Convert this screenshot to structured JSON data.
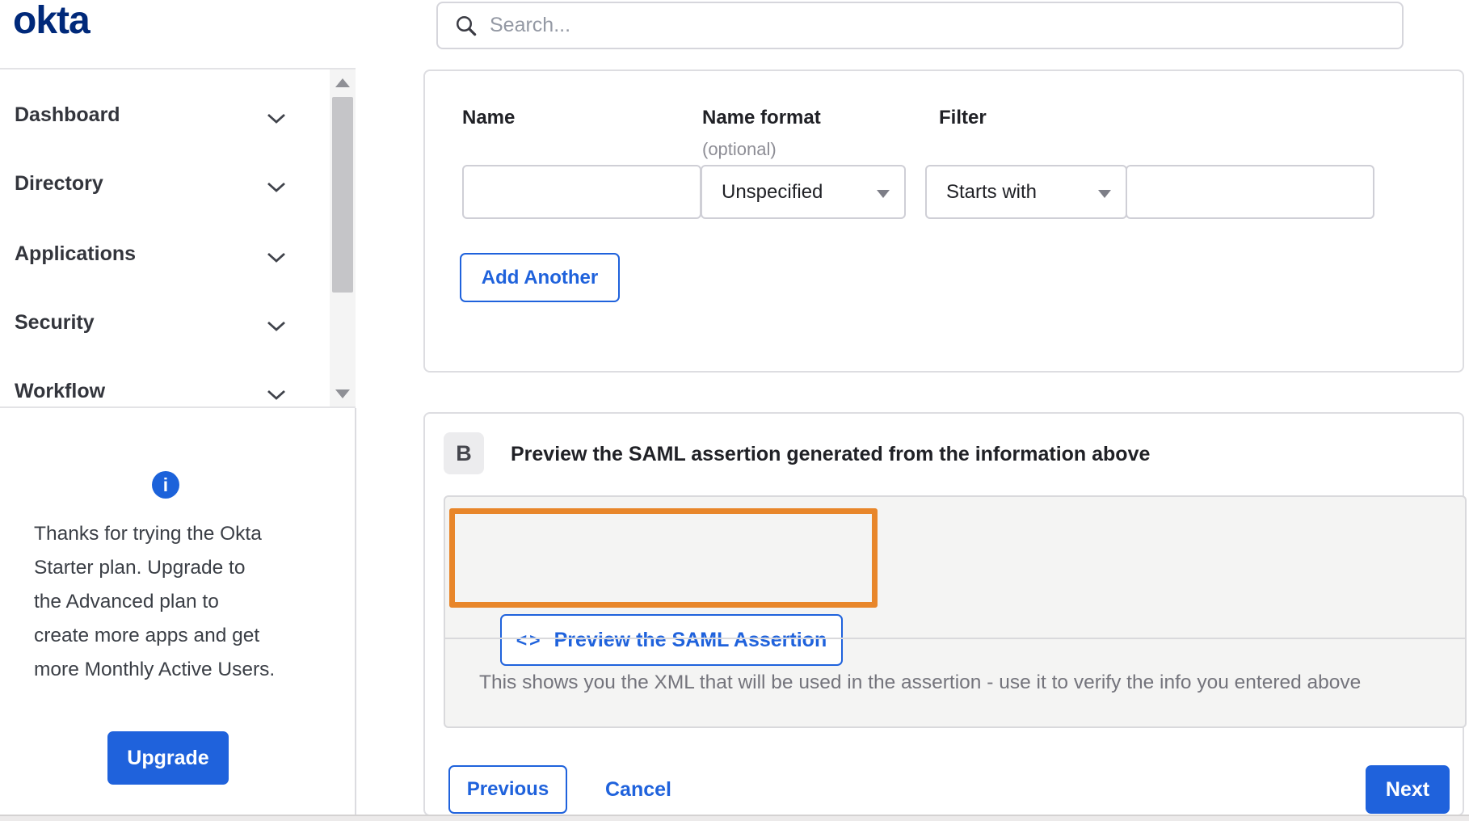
{
  "topbar": {
    "logo_text": "okta",
    "search_placeholder": "Search...",
    "search_value": ""
  },
  "sidebar": {
    "items": [
      {
        "label": "Dashboard"
      },
      {
        "label": "Directory"
      },
      {
        "label": "Applications"
      },
      {
        "label": "Security"
      },
      {
        "label": "Workflow"
      }
    ],
    "trial_text": "Thanks for trying the Okta\nStarter plan. Upgrade to\nthe Advanced plan to\ncreate more apps and get\nmore Monthly Active Users.",
    "upgrade_label": "Upgrade",
    "info_icon_glyph": "i"
  },
  "attribute_form": {
    "name_label": "Name",
    "name_format_label": "Name format",
    "optional_label": "(optional)",
    "filter_label": "Filter",
    "name_value": "",
    "name_format_value": "Unspecified",
    "filter_condition_value": "Starts with",
    "filter_value": "",
    "add_another_label": "Add Another"
  },
  "preview_section": {
    "step_badge": "B",
    "title": "Preview the SAML assertion generated from the information above",
    "code_icon": "<>",
    "preview_button_label": "Preview the SAML Assertion",
    "note": "This shows you the XML that will be used in the assertion - use it to verify the info you entered above"
  },
  "footer": {
    "previous_label": "Previous",
    "cancel_label": "Cancel",
    "next_label": "Next"
  },
  "colors": {
    "accent_blue": "#1f62dc",
    "logo_navy": "#00297a",
    "annotation_orange": "#e8862a",
    "panel_gray": "#f4f4f3",
    "border_gray": "#dddde1"
  }
}
